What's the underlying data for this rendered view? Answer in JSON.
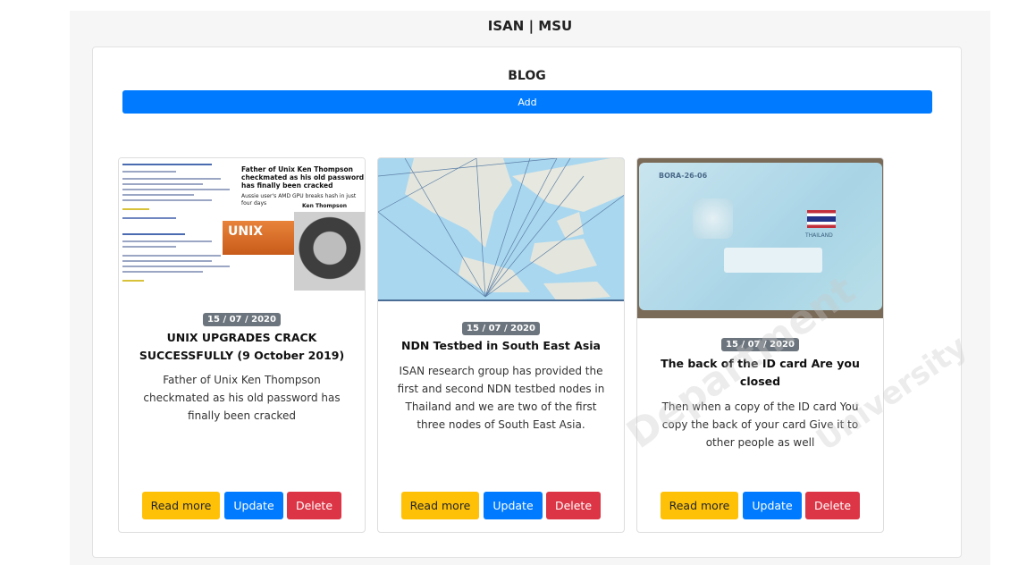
{
  "site": {
    "title": "ISAN | MSU"
  },
  "blog": {
    "heading": "BLOG",
    "add_label": "Add"
  },
  "cards": [
    {
      "date": "15 / 07 / 2020",
      "title": "UNIX UPGRADES CRACK SUCCESSFULLY (9 October 2019)",
      "body": "Father of Unix Ken Thompson checkmated as his old password has finally been cracked",
      "image": {
        "headline": "Father of Unix Ken Thompson checkmated as his old password has finally been cracked",
        "subline": "Aussie user's AMD GPU breaks hash in just four days",
        "unix_label": "UNIX",
        "photo_caption": "Ken Thompson"
      }
    },
    {
      "date": "15 / 07 / 2020",
      "title": "NDN Testbed in South East Asia",
      "body": "ISAN research group has provided the first and second NDN testbed nodes in Thailand and we are two of the first three nodes of South East Asia."
    },
    {
      "date": "15 / 07 / 2020",
      "title": "The back of the ID card Are you closed",
      "body": "Then when a copy of the ID card You copy the back of your card Give it to other people as well",
      "image": {
        "card_code": "BORA-26-06",
        "country_label": "THAILAND"
      }
    }
  ],
  "buttons": {
    "read_more": "Read more",
    "update": "Update",
    "delete": "Delete"
  },
  "watermark": {
    "line1": "Department",
    "line2": "University"
  }
}
